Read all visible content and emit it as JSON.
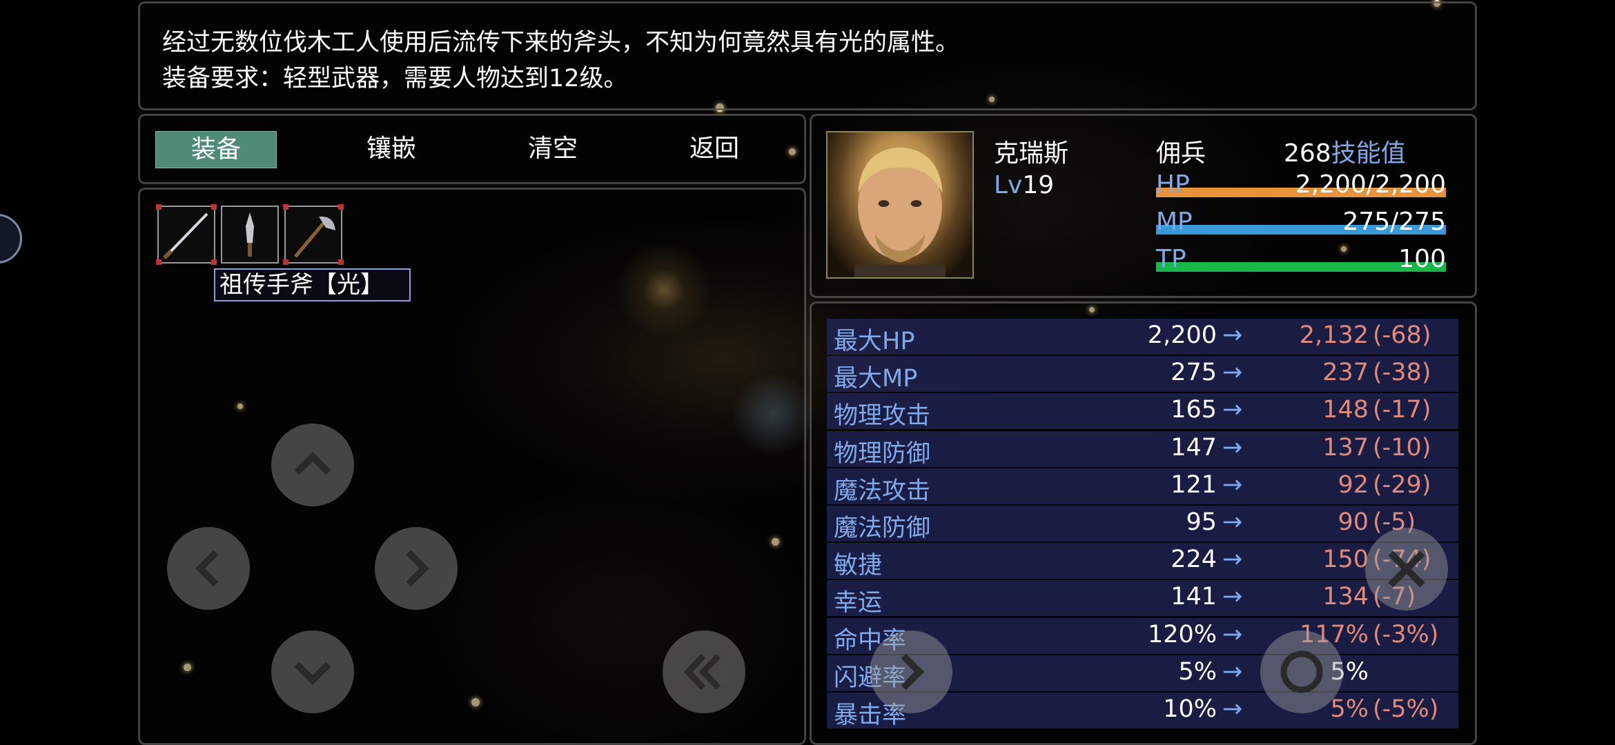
{
  "description": {
    "line1": "经过无数位伐木工人使用后流传下来的斧头，不知为何竟然具有光的属性。",
    "line2": "装备要求：轻型武器，需要人物达到12级。"
  },
  "commands": [
    "装备",
    "镶嵌",
    "清空",
    "返回"
  ],
  "equipment": {
    "slots": [
      "sword-icon",
      "dagger-icon",
      "axe-icon"
    ],
    "selected_label": "祖传手斧【光】"
  },
  "character": {
    "name": "克瑞斯",
    "class": "佣兵",
    "skill_points": "268",
    "skill_label": "技能值",
    "level_label": "Lv",
    "level": "19",
    "hp": {
      "label": "HP",
      "value": "2,200/2,200",
      "fraction": 1.0,
      "color": "#e8923a"
    },
    "mp": {
      "label": "MP",
      "value": "275/275",
      "fraction": 1.0,
      "color": "#3a9ad8"
    },
    "tp": {
      "label": "TP",
      "value": "100",
      "fraction": 1.0,
      "color": "#17b84a"
    }
  },
  "stats": [
    {
      "name": "最大HP",
      "current": "2,200",
      "arrow": "→",
      "new": "2,132",
      "diff": "(-68)"
    },
    {
      "name": "最大MP",
      "current": "275",
      "arrow": "→",
      "new": "237",
      "diff": "(-38)"
    },
    {
      "name": "物理攻击",
      "current": "165",
      "arrow": "→",
      "new": "148",
      "diff": "(-17)"
    },
    {
      "name": "物理防御",
      "current": "147",
      "arrow": "→",
      "new": "137",
      "diff": "(-10)"
    },
    {
      "name": "魔法攻击",
      "current": "121",
      "arrow": "→",
      "new": "92",
      "diff": "(-29)"
    },
    {
      "name": "魔法防御",
      "current": "95",
      "arrow": "→",
      "new": "90",
      "diff": "(-5)"
    },
    {
      "name": "敏捷",
      "current": "224",
      "arrow": "→",
      "new": "150",
      "diff": "(-74)"
    },
    {
      "name": "幸运",
      "current": "141",
      "arrow": "→",
      "new": "134",
      "diff": "(-7)"
    },
    {
      "name": "命中率",
      "current": "120%",
      "arrow": "→",
      "new": "117%",
      "diff": "(-3%)"
    },
    {
      "name": "闪避率",
      "current": "5%",
      "arrow": "→",
      "new": "5%",
      "diff": ""
    },
    {
      "name": "暴击率",
      "current": "10%",
      "arrow": "→",
      "new": "5%",
      "diff": "(-5%)"
    }
  ],
  "controls": {
    "dpad": [
      "chevron-up-icon",
      "chevron-left-icon",
      "chevron-right-icon",
      "chevron-down-icon"
    ],
    "rewind": "double-chevron-left-icon",
    "close": "close-icon",
    "forward": "chevron-right-icon",
    "ring": "ring-icon"
  }
}
